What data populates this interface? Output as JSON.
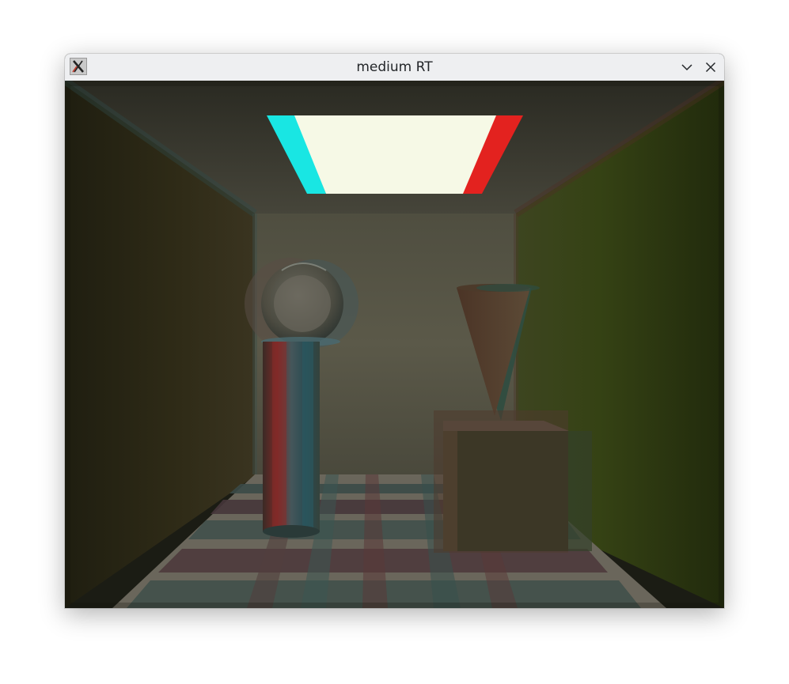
{
  "window": {
    "title": "medium RT",
    "icon": "x-app-icon",
    "controls": {
      "minimize_icon": "chevron-down-icon",
      "close_icon": "close-icon"
    }
  },
  "scene": {
    "description_colors": {
      "light": "#f6f9e6",
      "cyan_fringe": "#19e6e3",
      "red_fringe": "#e3221f",
      "left_wall": "#2f2c18",
      "right_wall": "#384418",
      "back_wall": "#5a5846",
      "ceiling": "#3a392e"
    }
  }
}
